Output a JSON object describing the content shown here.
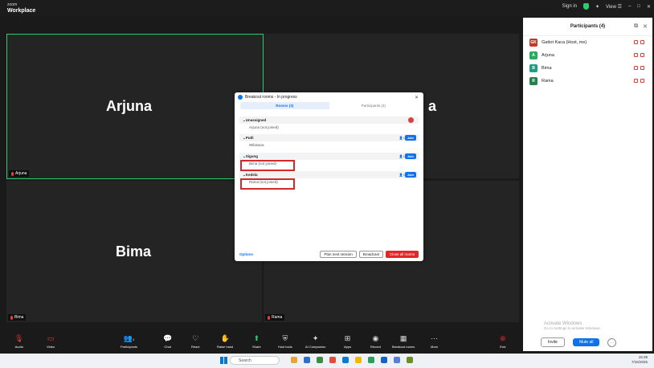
{
  "app": {
    "brand_top": "zoom",
    "brand_bottom": "Workplace",
    "sign_in": "Sign in",
    "view": "View"
  },
  "tiles": [
    {
      "name": "Arjuna",
      "tag": "Arjuna"
    },
    {
      "name": "Bima",
      "tag": "Bima"
    },
    {
      "tag": "Rama"
    }
  ],
  "partial_name": "a",
  "participants": {
    "title": "Participants (4)",
    "list": [
      {
        "initials": "GK",
        "name": "Gattot Kaca (Host, me)",
        "color": "#c0392b"
      },
      {
        "initials": "A",
        "name": "Arjuna",
        "color": "#27ae60"
      },
      {
        "initials": "B",
        "name": "Bima",
        "color": "#16a085"
      },
      {
        "initials": "R",
        "name": "Rama",
        "color": "#1e8449"
      }
    ],
    "mute_btn": "Invite",
    "mute_all": "Mute all",
    "more": "..."
  },
  "activate": {
    "title": "Activate Windows",
    "sub": "Go to Settings to activate Windows."
  },
  "breakout": {
    "title": "Breakout rooms - In progress",
    "tabs": [
      "Rooms (3)",
      "Participants (4)"
    ],
    "unassigned": {
      "label": "Unassigned",
      "member": "Arjuna (not joined)"
    },
    "rooms": [
      {
        "label": "Putli",
        "count": "1",
        "join": "Join",
        "member": "Wibisana"
      },
      {
        "label": "Sigung",
        "count": "1",
        "join": "Join",
        "member": "Bima (not joined)"
      },
      {
        "label": "Kedela",
        "count": "1",
        "join": "Join",
        "member": "Rama (not joined)"
      }
    ],
    "options": "Options",
    "buttons": [
      "Plan next session",
      "Broadcast",
      "Close all rooms"
    ]
  },
  "toolbar": [
    "Audio",
    "Video",
    "Participants",
    "Chat",
    "React",
    "Raise hand",
    "Share",
    "Host tools",
    "AI Companion",
    "Apps",
    "Record",
    "Breakout rooms",
    "More",
    "End"
  ],
  "participants_count": "4",
  "taskbar": {
    "search": "Search",
    "time": "15:39",
    "date": "7/16/2025"
  }
}
